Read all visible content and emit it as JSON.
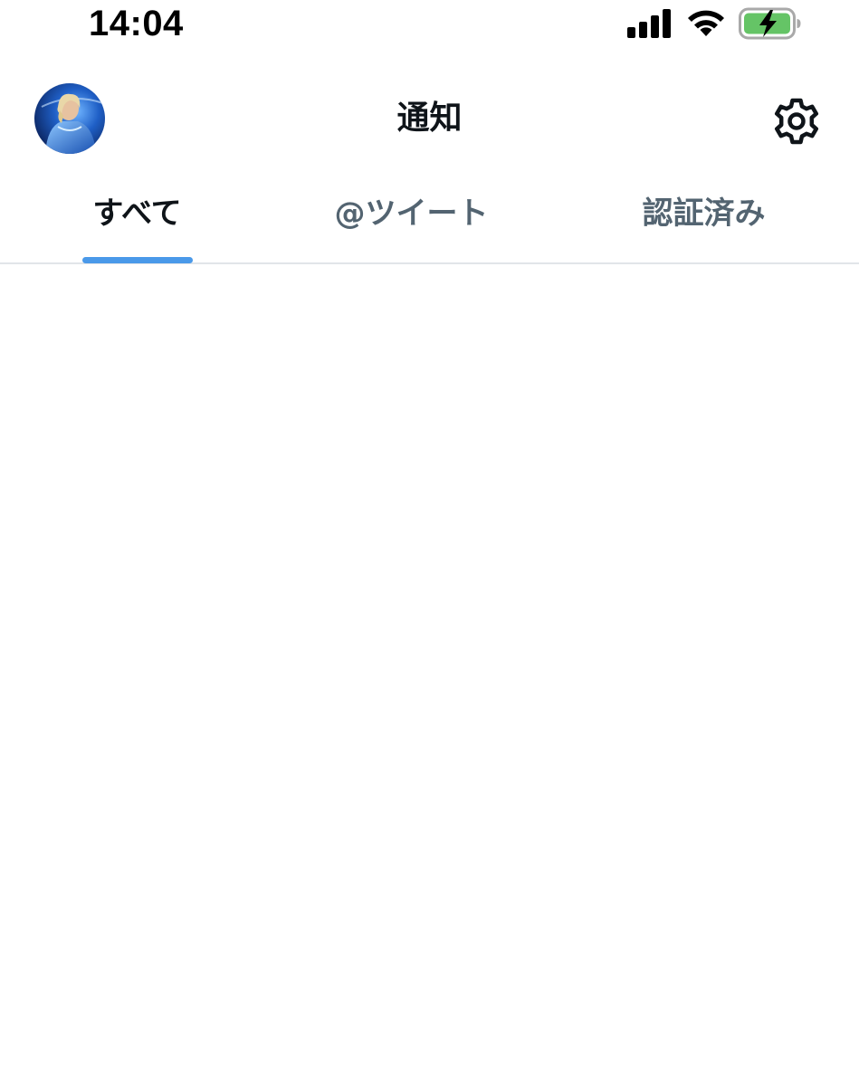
{
  "status_bar": {
    "time": "14:04",
    "icons": [
      "cellular-signal-icon",
      "wifi-icon",
      "battery-charging-icon"
    ]
  },
  "header": {
    "title": "通知",
    "avatar_icon": "profile-avatar",
    "settings_icon": "gear-icon"
  },
  "tabs": [
    {
      "label": "すべて",
      "selected": true
    },
    {
      "label": "@ツイート",
      "selected": false
    },
    {
      "label": "認証済み",
      "selected": false
    }
  ],
  "colors": {
    "accent": "#4a99e9",
    "text_primary": "#0f1419",
    "text_secondary": "#536471",
    "divider": "#e1e5e9",
    "battery_fill": "#65c466"
  }
}
